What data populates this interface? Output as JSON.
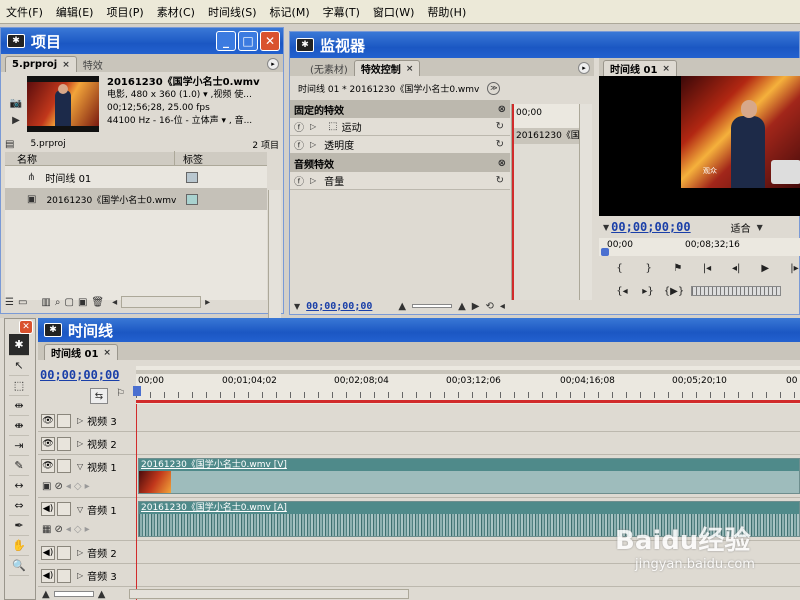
{
  "menu": [
    "文件(F)",
    "编辑(E)",
    "项目(P)",
    "素材(C)",
    "时间线(S)",
    "标记(M)",
    "字幕(T)",
    "窗口(W)",
    "帮助(H)"
  ],
  "project": {
    "title": "项目",
    "tabs": [
      "5.prproj",
      "特效"
    ],
    "clip_name": "20161230《国学小名士0.wmv",
    "clip_info1": "电影, 480 x 360 (1.0)  ▾ ,视频 使...",
    "clip_info2": "00;12;56;28, 25.00 fps",
    "clip_info3": "44100 Hz - 16-位 - 立体声  ▾ , 音...",
    "file_name": "5.prproj",
    "item_count": "2 项目",
    "col_name": "名称",
    "col_label": "标签",
    "items": [
      "时间线 01",
      "20161230《国学小名士0.wmv"
    ]
  },
  "monitor": {
    "title": "监视器",
    "tabs": [
      "(无素材)",
      "特效控制"
    ],
    "sequence_line": "时间线 01 * 20161230《国学小名士0.wmv",
    "ruler_start": "00;00",
    "mini_clip": "20161230《国学",
    "fixed_effects": "固定的特效",
    "motion": "运动",
    "opacity": "透明度",
    "audio_effects": "音频特效",
    "volume": "音量",
    "fx_timecode": "00;00;00;00"
  },
  "program": {
    "tab": "时间线 01",
    "timecode": "00;00;00;00",
    "fit": "适合",
    "ruler_left": "00;00",
    "ruler_mid": "00;08;32;16",
    "caption_text": "观众"
  },
  "timeline": {
    "title": "时间线",
    "tab": "时间线 01",
    "timecode": "00;00;00;00",
    "ruler": [
      "00;00",
      "00;01;04;02",
      "00;02;08;04",
      "00;03;12;06",
      "00;04;16;08",
      "00;05;20;10",
      "00"
    ],
    "tracks": [
      "视频 3",
      "视频 2",
      "视频 1",
      "音频 1",
      "音频 2",
      "音频 3"
    ],
    "video_clip": "20161230《国学小名士0.wmv [V]",
    "audio_clip": "20161230《国学小名士0.wmv [A]"
  },
  "watermark": {
    "brand": "Baidu经验",
    "url": "jingyan.baidu.com"
  },
  "colors": {
    "title_blue": "#1b57c3",
    "timecode_blue": "#1a3fa8",
    "clip_teal": "#4f8a8a",
    "playhead_red": "#d12b2b"
  }
}
